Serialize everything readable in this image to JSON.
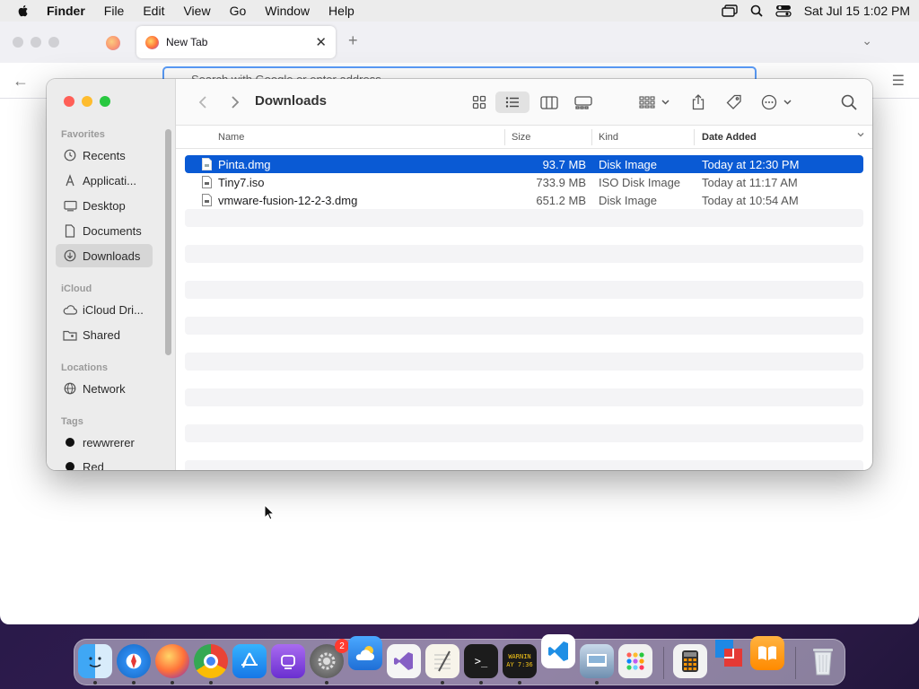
{
  "menubar": {
    "app": "Finder",
    "items": [
      "File",
      "Edit",
      "View",
      "Go",
      "Window",
      "Help"
    ],
    "clock": "Sat Jul 15  1:02 PM"
  },
  "browser": {
    "tab_title": "New Tab",
    "url_placeholder": "Search with Google or enter address"
  },
  "finder": {
    "title": "Downloads",
    "sidebar": {
      "favorites_heading": "Favorites",
      "favorites": [
        {
          "label": "Recents",
          "icon": "clock-icon"
        },
        {
          "label": "Applicati...",
          "icon": "applications-icon"
        },
        {
          "label": "Desktop",
          "icon": "desktop-icon"
        },
        {
          "label": "Documents",
          "icon": "document-icon"
        },
        {
          "label": "Downloads",
          "icon": "download-icon",
          "selected": true
        }
      ],
      "icloud_heading": "iCloud",
      "icloud": [
        {
          "label": "iCloud Dri...",
          "icon": "cloud-icon"
        },
        {
          "label": "Shared",
          "icon": "shared-folder-icon"
        }
      ],
      "locations_heading": "Locations",
      "locations": [
        {
          "label": "Network",
          "icon": "globe-icon"
        }
      ],
      "tags_heading": "Tags",
      "tags": [
        {
          "label": "rewwrerer",
          "color": "#111111"
        },
        {
          "label": "Red",
          "color": "#111111"
        }
      ]
    },
    "columns": {
      "name": "Name",
      "size": "Size",
      "kind": "Kind",
      "date": "Date Added"
    },
    "files": [
      {
        "name": "Pinta.dmg",
        "size": "93.7 MB",
        "kind": "Disk Image",
        "date": "Today at 12:30 PM",
        "selected": true
      },
      {
        "name": "Tiny7.iso",
        "size": "733.9 MB",
        "kind": "ISO Disk Image",
        "date": "Today at 11:17 AM"
      },
      {
        "name": "vmware-fusion-12-2-3.dmg",
        "size": "651.2 MB",
        "kind": "Disk Image",
        "date": "Today at 10:54 AM"
      }
    ]
  },
  "dock": {
    "badge_count": "2",
    "console_text": "WARNIN\nAY 7:36"
  },
  "colors": {
    "selection": "#0a5ad4",
    "close": "#ff5f57",
    "minimize": "#febc2e",
    "zoom": "#28c840"
  }
}
